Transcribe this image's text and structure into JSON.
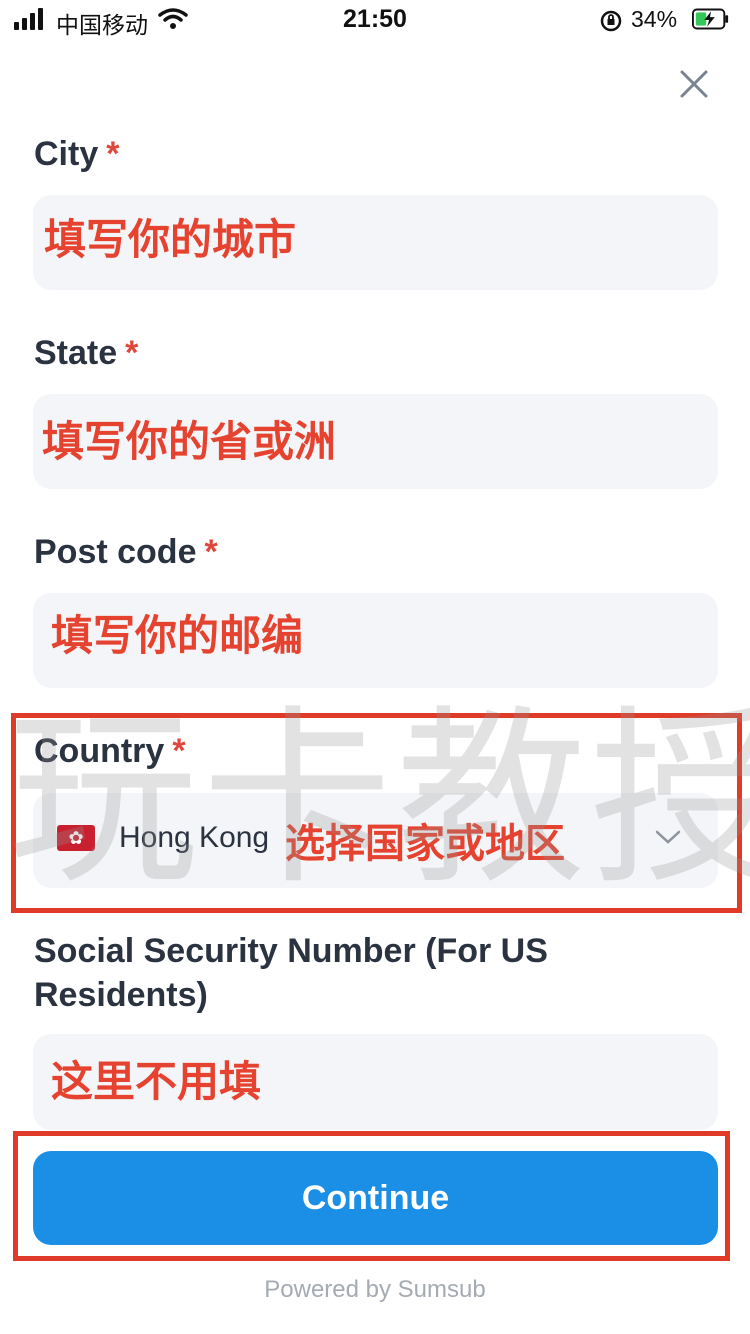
{
  "status_bar": {
    "carrier": "中国移动",
    "time": "21:50",
    "battery_percent": "34%"
  },
  "form": {
    "fields": [
      {
        "label": "City",
        "required_mark": "*",
        "annotation": "填写你的城市"
      },
      {
        "label": "State",
        "required_mark": "*",
        "annotation": "填写你的省或洲"
      },
      {
        "label": "Post code",
        "required_mark": "*",
        "annotation": "填写你的邮编"
      }
    ],
    "country": {
      "label": "Country",
      "required_mark": "*",
      "flag_icon": "hong-kong-flag-icon",
      "selected_value": "Hong Kong",
      "annotation": "选择国家或地区"
    },
    "ssn": {
      "label": "Social Security Number (For US Residents)",
      "annotation": "这里不用填"
    },
    "continue_label": "Continue",
    "footer": "Powered by Sumsub"
  },
  "watermark": "玩卡教授",
  "colors": {
    "accent": "#1b8fe6",
    "annotation": "#e5432f",
    "required": "#e0473c",
    "field_bg": "#f4f5f8"
  }
}
